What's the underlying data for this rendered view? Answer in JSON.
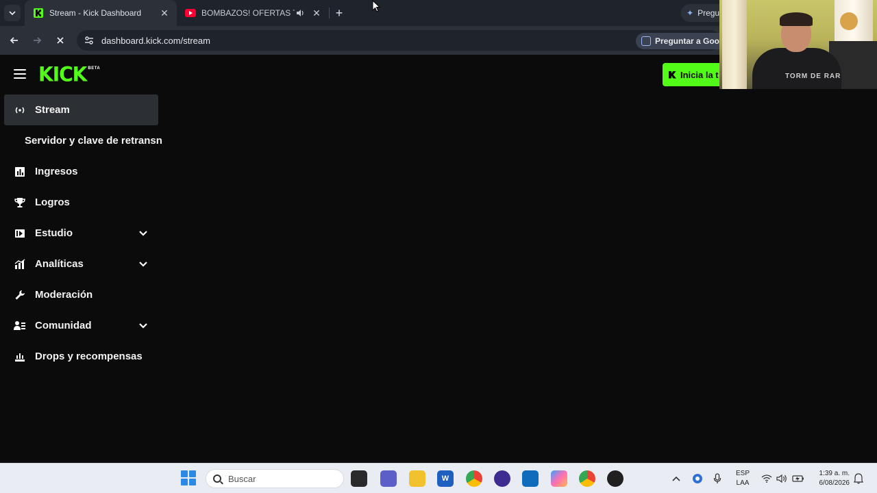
{
  "browser": {
    "tabs": [
      {
        "title": "Stream - Kick Dashboard",
        "active": true
      },
      {
        "title": "BOMBAZOS! OFERTAS TRAS",
        "active": false
      }
    ],
    "gemini_label": "Pregu",
    "url": "dashboard.kick.com/stream",
    "lens_label": "Preguntar a Goog"
  },
  "kick": {
    "logo_text": "KICK",
    "logo_badge": "BETA",
    "start_button_label": "Inicia la t",
    "accent": "#53fc18",
    "nav": [
      {
        "label": "Stream",
        "icon": "broadcast-icon",
        "active": true
      },
      {
        "label": "Servidor y clave de retransn",
        "icon": "",
        "sub": true
      },
      {
        "label": "Ingresos",
        "icon": "bar-chart-icon"
      },
      {
        "label": "Logros",
        "icon": "trophy-icon"
      },
      {
        "label": "Estudio",
        "icon": "studio-icon",
        "expandable": true
      },
      {
        "label": "Analíticas",
        "icon": "analytics-icon",
        "expandable": true
      },
      {
        "label": "Moderación",
        "icon": "wrench-icon"
      },
      {
        "label": "Comunidad",
        "icon": "community-icon",
        "expandable": true
      },
      {
        "label": "Drops y recompensas",
        "icon": "drops-icon"
      }
    ]
  },
  "webcam": {
    "shirt_text": "TORM DE RAR"
  },
  "taskbar": {
    "search_placeholder": "Buscar",
    "language_line1": "ESP",
    "language_line2": "LAA",
    "time": "1:39 a. m.",
    "date": "6/08/2026"
  }
}
